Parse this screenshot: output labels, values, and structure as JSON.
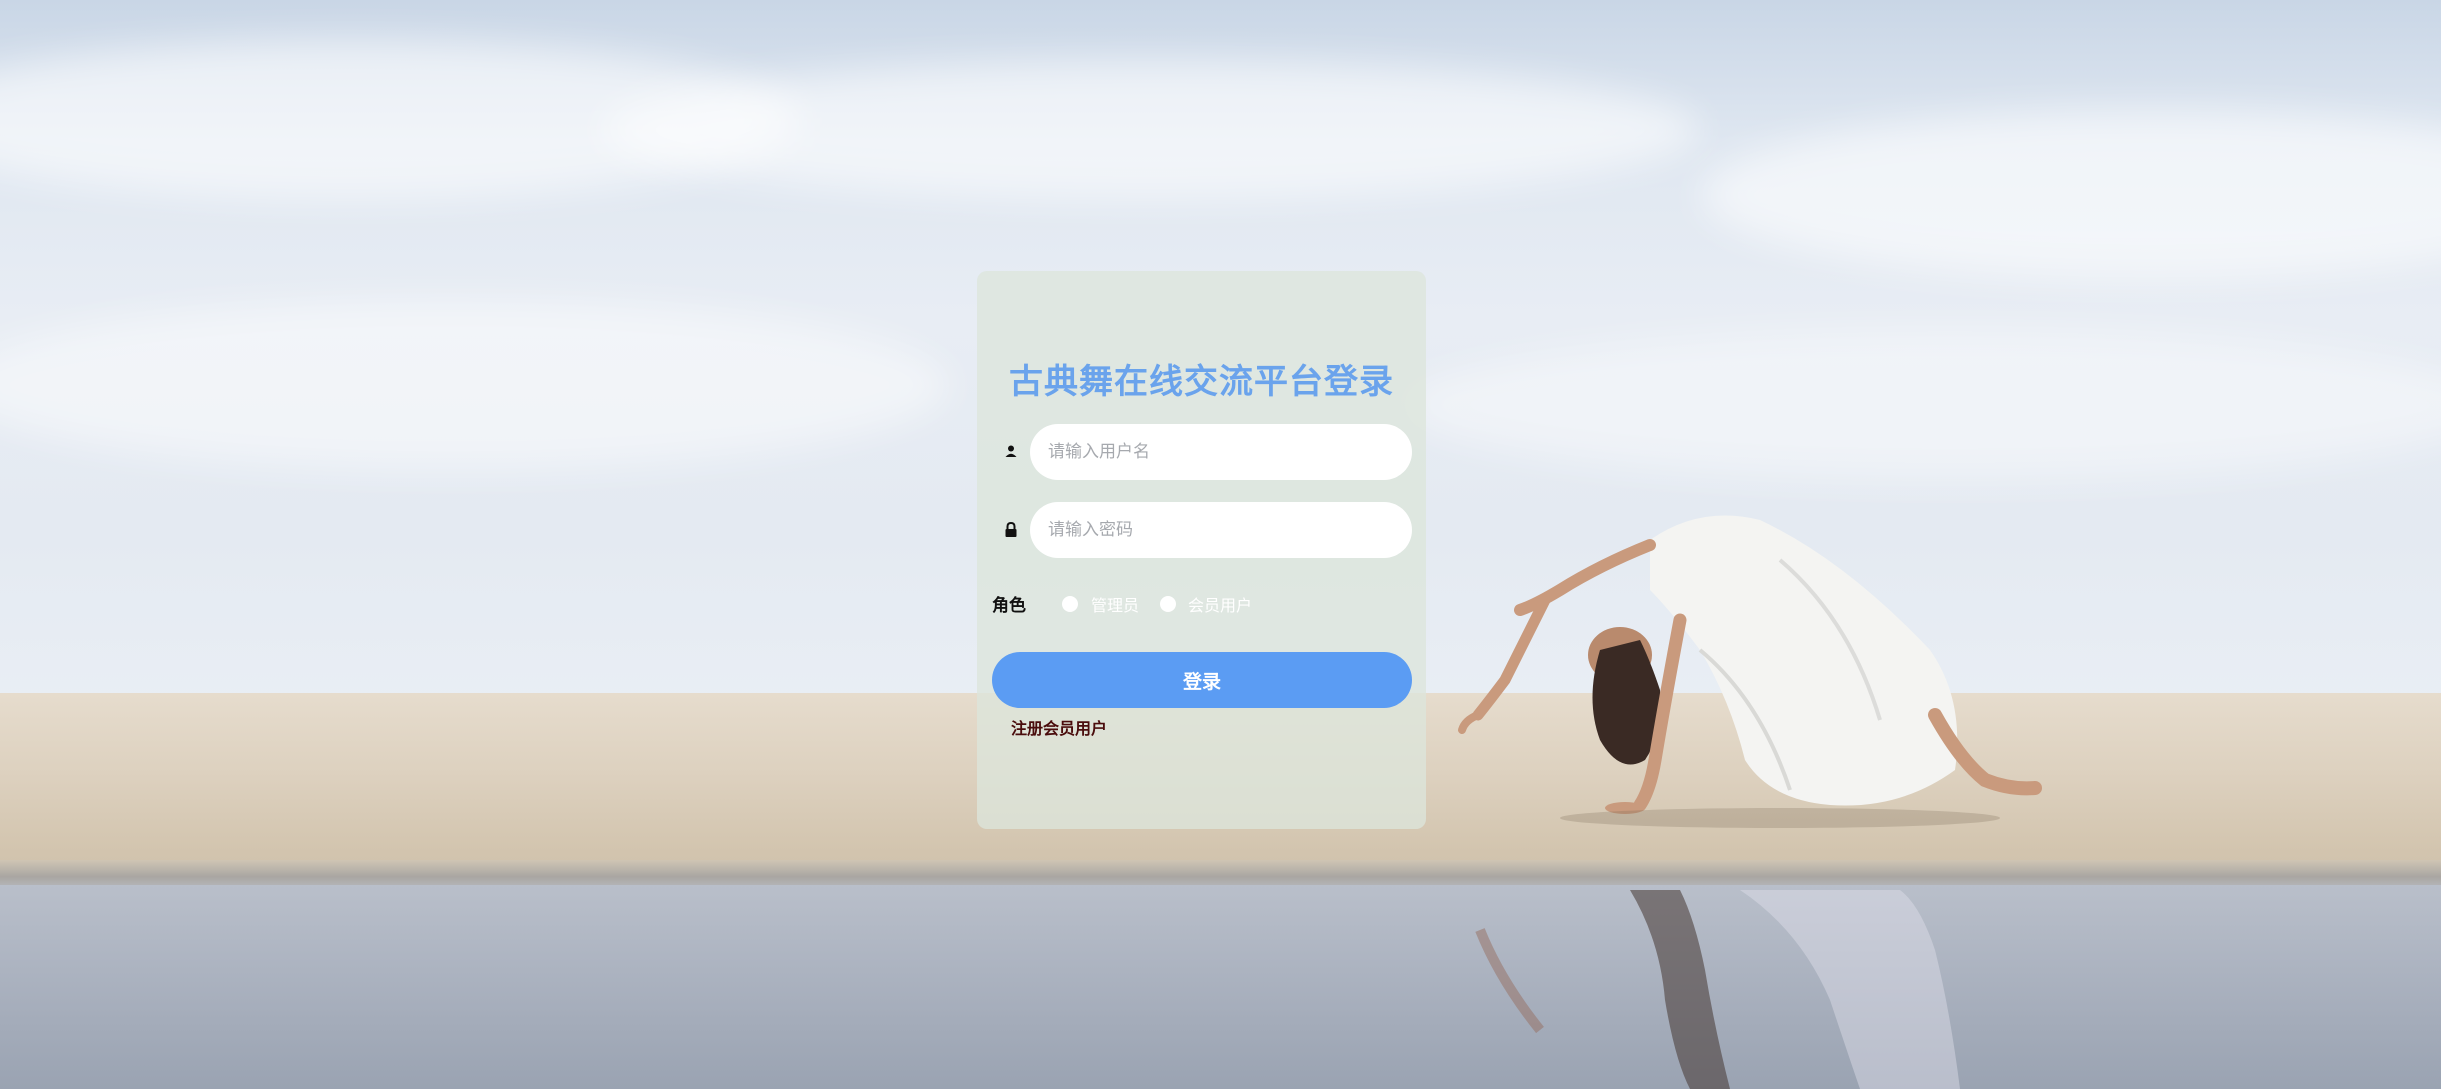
{
  "login": {
    "title": "古典舞在线交流平台登录",
    "username": {
      "placeholder": "请输入用户名",
      "icon": "user-icon"
    },
    "password": {
      "placeholder": "请输入密码",
      "icon": "lock-icon"
    },
    "role": {
      "label": "角色",
      "options": [
        "管理员",
        "会员用户"
      ]
    },
    "submit_label": "登录",
    "register_link": "注册会员用户"
  },
  "colors": {
    "title": "#6aa3ec",
    "button": "#5b9cf3",
    "panel": "#dde6db",
    "register_link": "#4a0c0c"
  }
}
